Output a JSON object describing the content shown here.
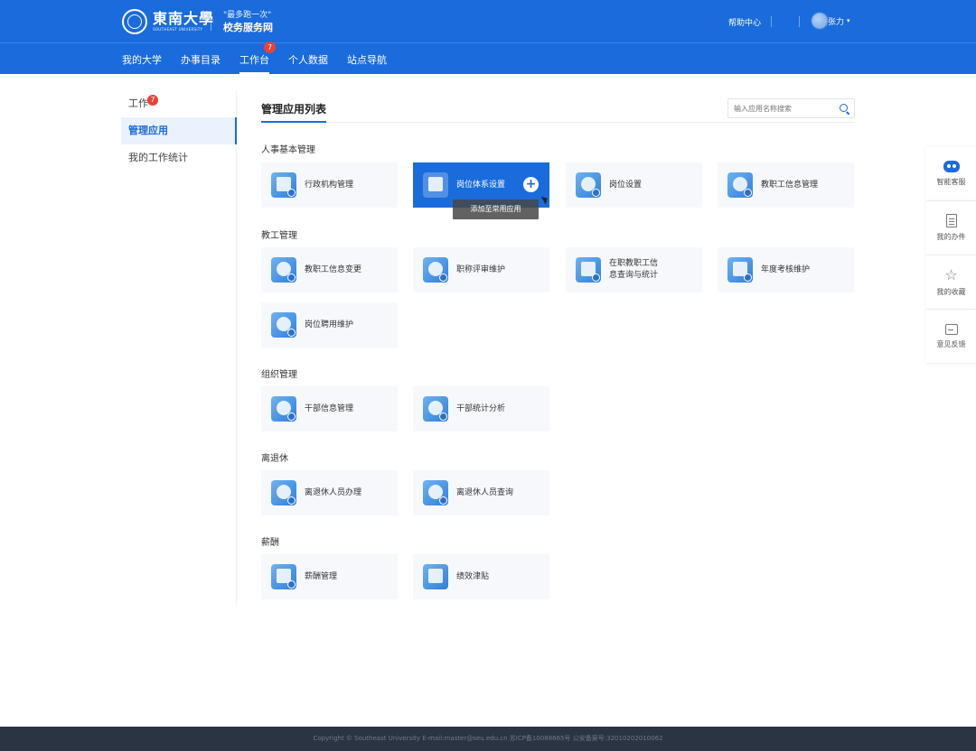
{
  "header": {
    "logo_cn": "東南大學",
    "logo_en": "SOUTHEAST UNIVERSITY",
    "slogan_top": "\"最多跑一次\"",
    "slogan_bottom": "校务服务网",
    "help": "帮助中心",
    "username": "张力",
    "caret": "▾"
  },
  "nav": {
    "items": [
      {
        "label": "我的大学"
      },
      {
        "label": "办事目录"
      },
      {
        "label": "工作台",
        "badge": "7"
      },
      {
        "label": "个人数据"
      },
      {
        "label": "站点导航"
      }
    ]
  },
  "sidebar": {
    "items": [
      {
        "label": "工作",
        "badge": "7"
      },
      {
        "label": "管理应用"
      },
      {
        "label": "我的工作统计"
      }
    ]
  },
  "main": {
    "title": "管理应用列表",
    "search_placeholder": "输入应用名称搜索",
    "sections": [
      {
        "title": "人事基本管理",
        "apps": [
          "行政机构管理",
          "岗位体系设置",
          "岗位设置",
          "教职工信息管理"
        ]
      },
      {
        "title": "教工管理",
        "apps": [
          "教职工信息变更",
          "职称评审维护",
          "在职教职工信",
          "年度考核维护",
          "岗位聘用维护"
        ],
        "app3_line2": "息查询与统计"
      },
      {
        "title": "组织管理",
        "apps": [
          "干部信息管理",
          "干部统计分析"
        ]
      },
      {
        "title": "离退休",
        "apps": [
          "离退休人员办理",
          "离退休人员查询"
        ]
      },
      {
        "title": "薪酬",
        "apps": [
          "薪酬管理",
          "绩效津贴"
        ]
      }
    ],
    "add_symbol": "+",
    "tooltip": "添加至常用应用"
  },
  "float_panel": {
    "items": [
      {
        "label": "智能客服",
        "icon": "robot-icon"
      },
      {
        "label": "我的办件",
        "icon": "document-icon"
      },
      {
        "label": "我的收藏",
        "icon": "star-icon"
      },
      {
        "label": "意见反馈",
        "icon": "feedback-icon"
      }
    ],
    "star_glyph": "☆"
  },
  "footer": {
    "text": "Copyright © Southeast University E-mail:master@seu.edu.cn   苏ICP备10088665号   公安备案号:32010202010062"
  },
  "colors": {
    "primary": "#1a6bdc",
    "badge": "#e8413a",
    "footer_bg": "#2a3442"
  }
}
